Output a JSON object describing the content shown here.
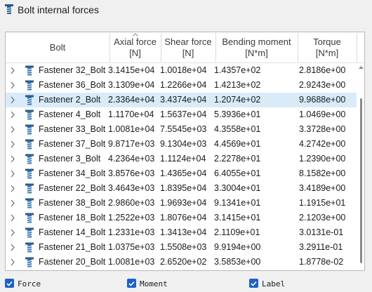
{
  "window": {
    "title": "Bolt internal forces"
  },
  "columns": [
    {
      "line1": "Bolt",
      "line2": ""
    },
    {
      "line1": "Axial force",
      "line2": "[N]"
    },
    {
      "line1": "Shear force",
      "line2": "[N]"
    },
    {
      "line1": "Bending moment",
      "line2": "[N*m]"
    },
    {
      "line1": "Torque",
      "line2": "[N*m]"
    }
  ],
  "rows": [
    {
      "name": "Fastener 32_Bolt",
      "axial": "3.1415e+04",
      "shear": "1.0018e+04",
      "bending": "1.4357e+02",
      "torque": "2.8186e+00"
    },
    {
      "name": "Fastener 36_Bolt",
      "axial": "3.1309e+04",
      "shear": "1.2266e+04",
      "bending": "1.4213e+02",
      "torque": "2.9243e+00"
    },
    {
      "name": "Fastener 2_Bolt",
      "axial": "2.3364e+04",
      "shear": "3.4374e+04",
      "bending": "1.2074e+02",
      "torque": "9.9688e+00"
    },
    {
      "name": "Fastener 4_Bolt",
      "axial": "1.1170e+04",
      "shear": "1.5637e+04",
      "bending": "5.3936e+01",
      "torque": "1.0469e+00"
    },
    {
      "name": "Fastener 33_Bolt",
      "axial": "1.0081e+04",
      "shear": "7.5545e+03",
      "bending": "4.3558e+01",
      "torque": "3.3728e+00"
    },
    {
      "name": "Fastener 37_Bolt",
      "axial": "9.8717e+03",
      "shear": "9.1304e+03",
      "bending": "4.4569e+01",
      "torque": "4.2742e+00"
    },
    {
      "name": "Fastener 3_Bolt",
      "axial": "4.2364e+03",
      "shear": "1.1124e+04",
      "bending": "2.2278e+01",
      "torque": "1.2390e+00"
    },
    {
      "name": "Fastener 34_Bolt",
      "axial": "3.8576e+03",
      "shear": "1.4365e+04",
      "bending": "6.4055e+01",
      "torque": "8.1582e+00"
    },
    {
      "name": "Fastener 22_Bolt",
      "axial": "3.4643e+03",
      "shear": "1.8395e+04",
      "bending": "3.3004e+01",
      "torque": "3.4189e+00"
    },
    {
      "name": "Fastener 38_Bolt",
      "axial": "2.9860e+03",
      "shear": "1.9693e+04",
      "bending": "9.1341e+01",
      "torque": "1.1915e+01"
    },
    {
      "name": "Fastener 18_Bolt",
      "axial": "1.2522e+03",
      "shear": "1.8076e+04",
      "bending": "3.1415e+01",
      "torque": "2.1203e+00"
    },
    {
      "name": "Fastener 14_Bolt",
      "axial": "1.2331e+03",
      "shear": "1.3413e+04",
      "bending": "2.1109e+01",
      "torque": "3.0131e-01"
    },
    {
      "name": "Fastener 21_Bolt",
      "axial": "1.0375e+03",
      "shear": "1.5508e+03",
      "bending": "9.9194e+00",
      "torque": "3.2911e-01"
    },
    {
      "name": "Fastener 20_Bolt",
      "axial": "1.0081e+03",
      "shear": "2.6520e+02",
      "bending": "3.5853e+00",
      "torque": "1.8778e-02"
    }
  ],
  "selected_row": "Fastener 2_Bolt",
  "sorted_column": "Axial force",
  "options": [
    {
      "label": "Force",
      "checked": true
    },
    {
      "label": "Moment",
      "checked": true
    },
    {
      "label": "Label",
      "checked": true
    }
  ],
  "colors": {
    "selection": "#d9ebf9",
    "checkbox": "#1d62c4",
    "icon": "#2a5c8f"
  },
  "icons": {
    "title": "bolt-icon",
    "row": "bolt-icon",
    "expander": "chevron-right-icon"
  }
}
